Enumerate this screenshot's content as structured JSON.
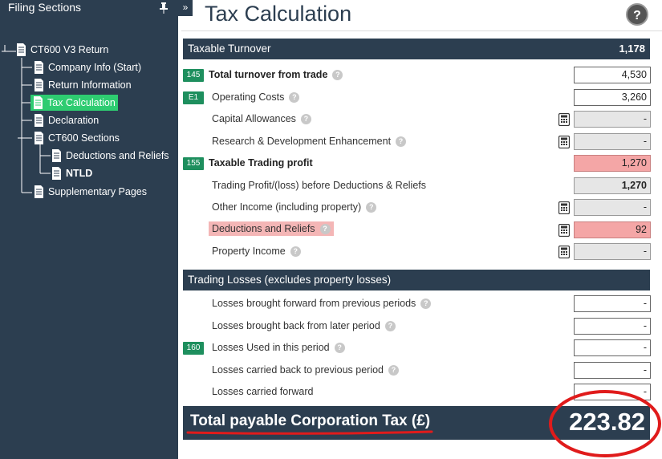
{
  "sidebar": {
    "title": "Filing Sections",
    "tree": {
      "root": "CT600 V3 Return",
      "company_info": "Company Info (Start)",
      "return_information": "Return Information",
      "tax_calculation": "Tax Calculation",
      "declaration": "Declaration",
      "ct600_sections": "CT600 Sections",
      "deductions_reliefs": "Deductions and Reliefs",
      "ntld": "NTLD",
      "supplementary": "Supplementary Pages"
    },
    "collapse_glyph": "»"
  },
  "main": {
    "title": "Tax Calculation",
    "help_glyph": "?",
    "taxable_turnover": {
      "header": "Taxable Turnover",
      "header_value": "1,178",
      "rows": [
        {
          "code": "145",
          "label": "Total turnover from trade",
          "value": "4,530"
        },
        {
          "code": "E1",
          "label": "Operating Costs",
          "value": "3,260"
        },
        {
          "code": "",
          "label": "Capital Allowances",
          "value": "-"
        },
        {
          "code": "",
          "label": "Research & Development Enhancement",
          "value": "-"
        },
        {
          "code": "155",
          "label": "Taxable Trading profit",
          "value": "1,270"
        },
        {
          "code": "",
          "label": "Trading Profit/(loss) before Deductions & Reliefs",
          "value": "1,270"
        },
        {
          "code": "",
          "label": "Other Income (including property)",
          "value": "-"
        },
        {
          "code": "",
          "label": "Deductions and Reliefs",
          "value": "92"
        },
        {
          "code": "",
          "label": "Property Income",
          "value": "-"
        }
      ]
    },
    "trading_losses": {
      "header": "Trading Losses (excludes property losses)",
      "rows": [
        {
          "code": "",
          "label": "Losses brought forward from previous periods",
          "value": "-"
        },
        {
          "code": "",
          "label": "Losses brought back from later period",
          "value": "-"
        },
        {
          "code": "160",
          "label": "Losses Used in this period",
          "value": "-"
        },
        {
          "code": "",
          "label": "Losses carried back to previous period",
          "value": "-"
        },
        {
          "code": "",
          "label": "Losses carried forward",
          "value": "-"
        }
      ]
    },
    "total": {
      "label": "Total payable Corporation Tax (£)",
      "value": "223.82"
    }
  },
  "colors": {
    "sidebar_bg": "#2c3e50",
    "active_item": "#2ecc71",
    "code_badge": "#1e8f5e",
    "error_field": "#f4a6a6",
    "annotation_red": "#e01b1b"
  }
}
